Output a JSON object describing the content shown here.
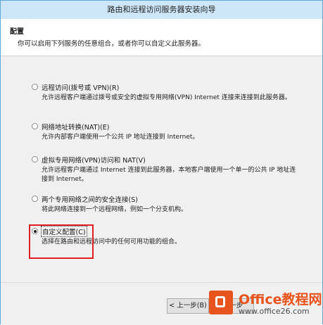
{
  "window": {
    "title": "路由和远程访问服务器安装向导"
  },
  "header": {
    "title": "配置",
    "subtitle": "你可以启用下列服务的任意组合，或者你可以自定义此服务器。"
  },
  "options": [
    {
      "label": "远程访问(拨号或 VPN)(R)",
      "description": "允许远程客户端通过拨号或安全的虚拟专用网络(VPN) Internet 连接来连接到此服务器。",
      "selected": false
    },
    {
      "label": "网络地址转换(NAT)(E)",
      "description": "允许内部客户端使用一个公共 IP 地址连接到 Internet。",
      "selected": false
    },
    {
      "label": "虚拟专用网络(VPN)访问和 NAT(V)",
      "description": "允许远程客户端通过 Internet 连接到此服务器，本地客户端使用一个单一的公共 IP 地址连接到 Internet。",
      "selected": false
    },
    {
      "label": "两个专用网络之间的安全连接(S)",
      "description": "将此网络连接到一个远程网络，例如一个分支机构。",
      "selected": false
    },
    {
      "label": "自定义配置(C)",
      "description": "选择在路由和远程访问中的任何可用功能的组合。",
      "selected": true
    }
  ],
  "buttons": {
    "back": "< 上一步(B)",
    "next": "下一步"
  },
  "watermark": {
    "brand": "Office教程网",
    "url": "www.office26.com"
  },
  "colors": {
    "title_bar": "#cde7f8",
    "highlight_box": "#e02020",
    "watermark": "#e8541d"
  }
}
